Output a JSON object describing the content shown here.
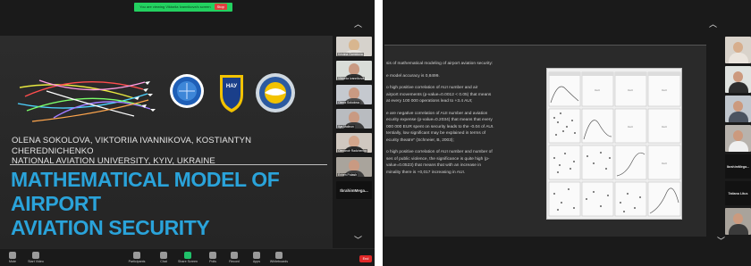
{
  "left": {
    "share_banner": "You are viewing Viktoriia Ivannikova's screen",
    "stop_label": "Stop",
    "slide": {
      "authors_line1": "OLENA SOKOLOVA, VIKTORIIA IVANNIKOVA, KOSTIANTYN CHEREDNICHENKO",
      "authors_line2": "NATIONAL AVIATION UNIVERSITY, KYIV, UKRAINE",
      "title_line1": "MATHEMATICAL MODEL OF AIRPORT",
      "title_line2": "AVIATION SECURITY",
      "badge_text": "NAY"
    },
    "participants": [
      "Kristina Gamidova",
      "Viktoriia Ivannikova",
      "Olena Sokolova",
      "Ilya Malinov",
      "Olexandr Radchenko",
      "Evhen Potash",
      "IbrahimMega..."
    ],
    "toolbar": [
      {
        "label": "Mute",
        "key": "mute"
      },
      {
        "label": "Start Video",
        "key": "video"
      },
      {
        "label": "Participants",
        "key": "participants"
      },
      {
        "label": "Chat",
        "key": "chat"
      },
      {
        "label": "Share Screen",
        "key": "share"
      },
      {
        "label": "Polls",
        "key": "polls"
      },
      {
        "label": "Record",
        "key": "record"
      },
      {
        "label": "Apps",
        "key": "apps"
      },
      {
        "label": "Whiteboards",
        "key": "whiteboards"
      }
    ],
    "end_label": "End"
  },
  "right": {
    "heading": "sis of mathematical modeling of airport aviation security:",
    "p1": "e model accuracy is 0,8499.",
    "p2_lines": [
      "o high positive correlation of AUI number and air",
      "airport movements (p-value=0.0012 < 0.05) that means",
      "at every 100 000 operations lead to +3.4 AUI;"
    ],
    "p3_lines": [
      "e are negative correlation of AUI number and aviation",
      "ecurity expense (p-value=0.2034) that means that every",
      "000 000 EUR spent on security leads to the -0.04 of AUI.",
      "tentially, low significant may be explained in terms of",
      "ecurity theatre\" (Schneier, B, 2003);"
    ],
    "p4_lines": [
      "o high positive correlation of AUI number and number of",
      "ses of public violence, the significance is quite high (p-",
      "value=0.0523) that means that with an increase in",
      "minality there is +0,017 increasing in AUI."
    ],
    "participants": [
      "IbrahimMega...",
      "Tatiana Litus"
    ]
  }
}
